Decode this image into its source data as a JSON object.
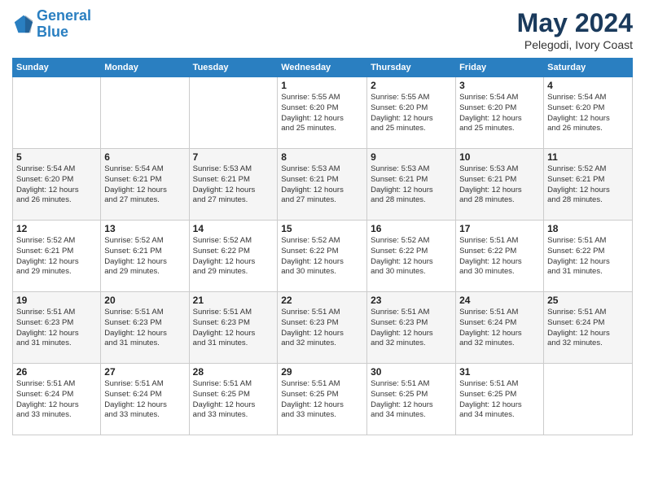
{
  "header": {
    "logo_line1": "General",
    "logo_line2": "Blue",
    "title": "May 2024",
    "subtitle": "Pelegodi, Ivory Coast"
  },
  "weekdays": [
    "Sunday",
    "Monday",
    "Tuesday",
    "Wednesday",
    "Thursday",
    "Friday",
    "Saturday"
  ],
  "weeks": [
    [
      {
        "day": "",
        "info": ""
      },
      {
        "day": "",
        "info": ""
      },
      {
        "day": "",
        "info": ""
      },
      {
        "day": "1",
        "info": "Sunrise: 5:55 AM\nSunset: 6:20 PM\nDaylight: 12 hours\nand 25 minutes."
      },
      {
        "day": "2",
        "info": "Sunrise: 5:55 AM\nSunset: 6:20 PM\nDaylight: 12 hours\nand 25 minutes."
      },
      {
        "day": "3",
        "info": "Sunrise: 5:54 AM\nSunset: 6:20 PM\nDaylight: 12 hours\nand 25 minutes."
      },
      {
        "day": "4",
        "info": "Sunrise: 5:54 AM\nSunset: 6:20 PM\nDaylight: 12 hours\nand 26 minutes."
      }
    ],
    [
      {
        "day": "5",
        "info": "Sunrise: 5:54 AM\nSunset: 6:20 PM\nDaylight: 12 hours\nand 26 minutes."
      },
      {
        "day": "6",
        "info": "Sunrise: 5:54 AM\nSunset: 6:21 PM\nDaylight: 12 hours\nand 27 minutes."
      },
      {
        "day": "7",
        "info": "Sunrise: 5:53 AM\nSunset: 6:21 PM\nDaylight: 12 hours\nand 27 minutes."
      },
      {
        "day": "8",
        "info": "Sunrise: 5:53 AM\nSunset: 6:21 PM\nDaylight: 12 hours\nand 27 minutes."
      },
      {
        "day": "9",
        "info": "Sunrise: 5:53 AM\nSunset: 6:21 PM\nDaylight: 12 hours\nand 28 minutes."
      },
      {
        "day": "10",
        "info": "Sunrise: 5:53 AM\nSunset: 6:21 PM\nDaylight: 12 hours\nand 28 minutes."
      },
      {
        "day": "11",
        "info": "Sunrise: 5:52 AM\nSunset: 6:21 PM\nDaylight: 12 hours\nand 28 minutes."
      }
    ],
    [
      {
        "day": "12",
        "info": "Sunrise: 5:52 AM\nSunset: 6:21 PM\nDaylight: 12 hours\nand 29 minutes."
      },
      {
        "day": "13",
        "info": "Sunrise: 5:52 AM\nSunset: 6:21 PM\nDaylight: 12 hours\nand 29 minutes."
      },
      {
        "day": "14",
        "info": "Sunrise: 5:52 AM\nSunset: 6:22 PM\nDaylight: 12 hours\nand 29 minutes."
      },
      {
        "day": "15",
        "info": "Sunrise: 5:52 AM\nSunset: 6:22 PM\nDaylight: 12 hours\nand 30 minutes."
      },
      {
        "day": "16",
        "info": "Sunrise: 5:52 AM\nSunset: 6:22 PM\nDaylight: 12 hours\nand 30 minutes."
      },
      {
        "day": "17",
        "info": "Sunrise: 5:51 AM\nSunset: 6:22 PM\nDaylight: 12 hours\nand 30 minutes."
      },
      {
        "day": "18",
        "info": "Sunrise: 5:51 AM\nSunset: 6:22 PM\nDaylight: 12 hours\nand 31 minutes."
      }
    ],
    [
      {
        "day": "19",
        "info": "Sunrise: 5:51 AM\nSunset: 6:23 PM\nDaylight: 12 hours\nand 31 minutes."
      },
      {
        "day": "20",
        "info": "Sunrise: 5:51 AM\nSunset: 6:23 PM\nDaylight: 12 hours\nand 31 minutes."
      },
      {
        "day": "21",
        "info": "Sunrise: 5:51 AM\nSunset: 6:23 PM\nDaylight: 12 hours\nand 31 minutes."
      },
      {
        "day": "22",
        "info": "Sunrise: 5:51 AM\nSunset: 6:23 PM\nDaylight: 12 hours\nand 32 minutes."
      },
      {
        "day": "23",
        "info": "Sunrise: 5:51 AM\nSunset: 6:23 PM\nDaylight: 12 hours\nand 32 minutes."
      },
      {
        "day": "24",
        "info": "Sunrise: 5:51 AM\nSunset: 6:24 PM\nDaylight: 12 hours\nand 32 minutes."
      },
      {
        "day": "25",
        "info": "Sunrise: 5:51 AM\nSunset: 6:24 PM\nDaylight: 12 hours\nand 32 minutes."
      }
    ],
    [
      {
        "day": "26",
        "info": "Sunrise: 5:51 AM\nSunset: 6:24 PM\nDaylight: 12 hours\nand 33 minutes."
      },
      {
        "day": "27",
        "info": "Sunrise: 5:51 AM\nSunset: 6:24 PM\nDaylight: 12 hours\nand 33 minutes."
      },
      {
        "day": "28",
        "info": "Sunrise: 5:51 AM\nSunset: 6:25 PM\nDaylight: 12 hours\nand 33 minutes."
      },
      {
        "day": "29",
        "info": "Sunrise: 5:51 AM\nSunset: 6:25 PM\nDaylight: 12 hours\nand 33 minutes."
      },
      {
        "day": "30",
        "info": "Sunrise: 5:51 AM\nSunset: 6:25 PM\nDaylight: 12 hours\nand 34 minutes."
      },
      {
        "day": "31",
        "info": "Sunrise: 5:51 AM\nSunset: 6:25 PM\nDaylight: 12 hours\nand 34 minutes."
      },
      {
        "day": "",
        "info": ""
      }
    ]
  ]
}
